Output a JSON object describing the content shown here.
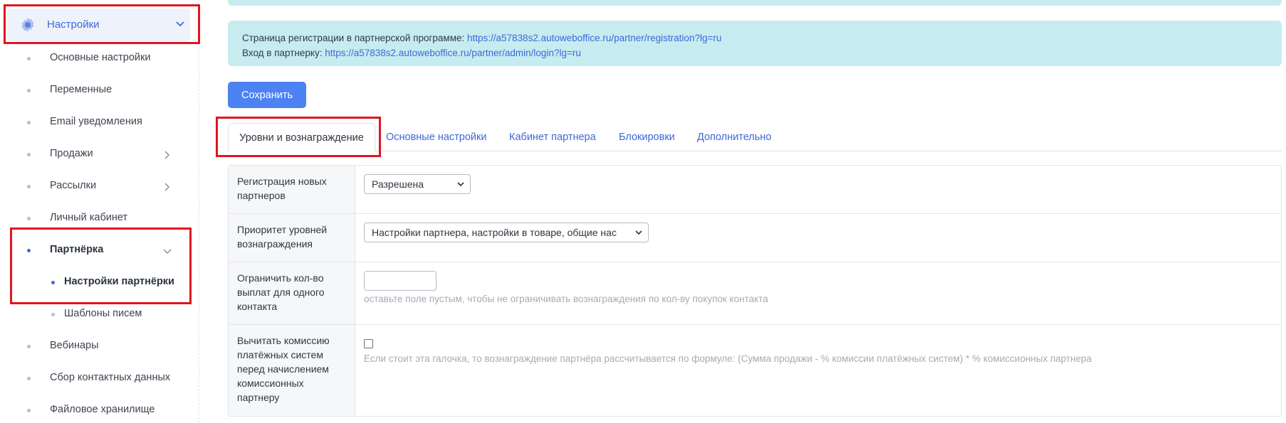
{
  "sidebar": {
    "settings_label": "Настройки",
    "items": [
      {
        "label": "Основные настройки"
      },
      {
        "label": "Переменные"
      },
      {
        "label": "Email уведомления"
      },
      {
        "label": "Продажи"
      },
      {
        "label": "Рассылки"
      },
      {
        "label": "Личный кабинет"
      },
      {
        "label": "Партнёрка"
      },
      {
        "label": "Настройки партнёрки"
      },
      {
        "label": "Шаблоны писем"
      },
      {
        "label": "Вебинары"
      },
      {
        "label": "Сбор контактных данных"
      },
      {
        "label": "Файловое хранилище"
      }
    ]
  },
  "info": {
    "reg_label": "Страница регистрации в партнерской программе:",
    "reg_url": "https://a57838s2.autoweboffice.ru/partner/registration?lg=ru",
    "login_label": "Вход в партнерку:",
    "login_url": "https://a57838s2.autoweboffice.ru/partner/admin/login?lg=ru"
  },
  "toolbar": {
    "save_label": "Сохранить"
  },
  "tabs": [
    {
      "label": "Уровни и вознаграждение"
    },
    {
      "label": "Основные настройки"
    },
    {
      "label": "Кабинет партнера"
    },
    {
      "label": "Блокировки"
    },
    {
      "label": "Дополнительно"
    }
  ],
  "form": {
    "registration": {
      "label": "Регистрация новых партнеров",
      "value": "Разрешена"
    },
    "priority": {
      "label": "Приоритет уровней вознаграждения",
      "value": "Настройки партнера, настройки в товаре, общие нас"
    },
    "limit": {
      "label": "Ограничить кол-во выплат для одного контакта",
      "value": "",
      "hint": "оставьте поле пустым, чтобы не ограничивать вознаграждения по кол-ву покупок контакта"
    },
    "commission": {
      "label": "Вычитать комиссию платёжных систем перед начислением комиссионных партнеру",
      "hint": "Если стоит эта галочка, то вознаграждение партнёра рассчитывается по формуле: (Сумма продажи - % комиссии платёжных систем) * % комиссионных партнера"
    }
  },
  "colors": {
    "accent": "#4d82f3",
    "link": "#3e68d8",
    "info_bg": "#c6ecf0",
    "highlight": "#e0151f"
  }
}
